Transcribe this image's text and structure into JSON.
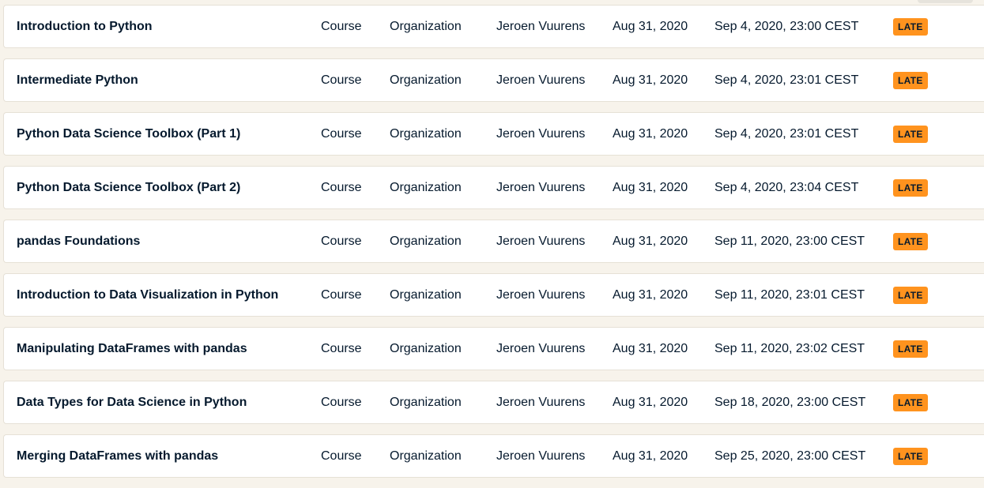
{
  "assignments": [
    {
      "title": "Introduction to Python",
      "type": "Course",
      "scope": "Organization",
      "assigned_by": "Jeroen Vuurens",
      "assigned_on": "Aug 31, 2020",
      "due": "Sep 4, 2020, 23:00 CEST",
      "status": "LATE"
    },
    {
      "title": "Intermediate Python",
      "type": "Course",
      "scope": "Organization",
      "assigned_by": "Jeroen Vuurens",
      "assigned_on": "Aug 31, 2020",
      "due": "Sep 4, 2020, 23:01 CEST",
      "status": "LATE"
    },
    {
      "title": "Python Data Science Toolbox (Part 1)",
      "type": "Course",
      "scope": "Organization",
      "assigned_by": "Jeroen Vuurens",
      "assigned_on": "Aug 31, 2020",
      "due": "Sep 4, 2020, 23:01 CEST",
      "status": "LATE"
    },
    {
      "title": "Python Data Science Toolbox (Part 2)",
      "type": "Course",
      "scope": "Organization",
      "assigned_by": "Jeroen Vuurens",
      "assigned_on": "Aug 31, 2020",
      "due": "Sep 4, 2020, 23:04 CEST",
      "status": "LATE"
    },
    {
      "title": "pandas Foundations",
      "type": "Course",
      "scope": "Organization",
      "assigned_by": "Jeroen Vuurens",
      "assigned_on": "Aug 31, 2020",
      "due": "Sep 11, 2020, 23:00 CEST",
      "status": "LATE"
    },
    {
      "title": "Introduction to Data Visualization in Python",
      "type": "Course",
      "scope": "Organization",
      "assigned_by": "Jeroen Vuurens",
      "assigned_on": "Aug 31, 2020",
      "due": "Sep 11, 2020, 23:01 CEST",
      "status": "LATE"
    },
    {
      "title": "Manipulating DataFrames with pandas",
      "type": "Course",
      "scope": "Organization",
      "assigned_by": "Jeroen Vuurens",
      "assigned_on": "Aug 31, 2020",
      "due": "Sep 11, 2020, 23:02 CEST",
      "status": "LATE"
    },
    {
      "title": "Data Types for Data Science in Python",
      "type": "Course",
      "scope": "Organization",
      "assigned_by": "Jeroen Vuurens",
      "assigned_on": "Aug 31, 2020",
      "due": "Sep 18, 2020, 23:00 CEST",
      "status": "LATE"
    },
    {
      "title": "Merging DataFrames with pandas",
      "type": "Course",
      "scope": "Organization",
      "assigned_by": "Jeroen Vuurens",
      "assigned_on": "Aug 31, 2020",
      "due": "Sep 25, 2020, 23:00 CEST",
      "status": "LATE"
    }
  ],
  "colors": {
    "background": "#f7f3eb",
    "row_background": "#ffffff",
    "text": "#05192d",
    "late_badge": "#ff931e"
  }
}
